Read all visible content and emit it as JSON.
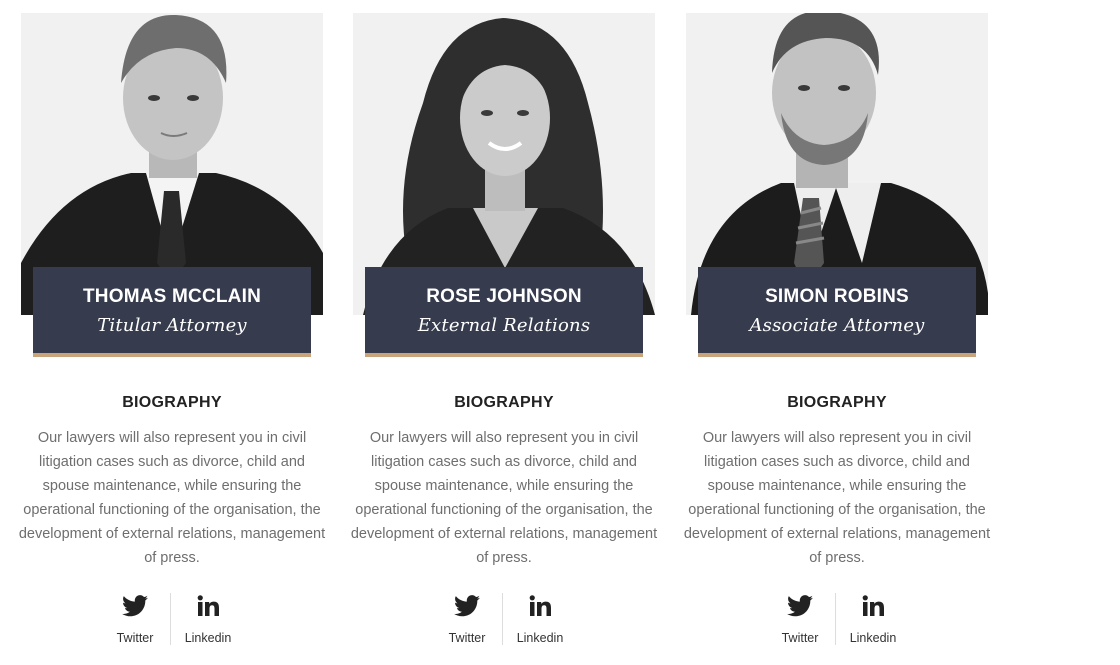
{
  "team": [
    {
      "name": "THOMAS MCCLAIN",
      "role": "Titular Attorney",
      "bio_heading": "BIOGRAPHY",
      "bio": "Our lawyers will also represent you in civil litigation cases such as divorce, child and spouse maintenance, while ensuring the operational functioning of the organisation, the development of external relations, management of press.",
      "twitter_label": "Twitter",
      "linkedin_label": "Linkedin"
    },
    {
      "name": "ROSE JOHNSON",
      "role": "External Relations",
      "bio_heading": "BIOGRAPHY",
      "bio": "Our lawyers will also represent you in civil litigation cases such as divorce, child and spouse maintenance, while ensuring the operational functioning of the organisation, the development of external relations, management of press.",
      "twitter_label": "Twitter",
      "linkedin_label": "Linkedin"
    },
    {
      "name": "SIMON ROBINS",
      "role": "Associate Attorney",
      "bio_heading": "BIOGRAPHY",
      "bio": "Our lawyers will also represent you in civil litigation cases such as divorce, child and spouse maintenance, while ensuring the operational functioning of the organisation, the development of external relations, management of press.",
      "twitter_label": "Twitter",
      "linkedin_label": "Linkedin"
    }
  ],
  "colors": {
    "nameplate": "#363b4e",
    "accent": "#c9a47a",
    "body_text": "#6e6e6e",
    "heading_text": "#222222"
  },
  "icons": [
    "twitter-icon",
    "linkedin-icon"
  ]
}
